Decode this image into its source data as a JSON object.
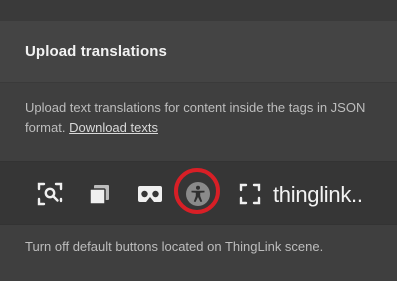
{
  "panel": {
    "title": "Upload translations",
    "description": "Upload text translations for content inside the tags in JSON format. ",
    "download_link": "Download texts",
    "footer_text": "Turn off default buttons located on ThingLink scene."
  },
  "toolbar": {
    "icons": [
      {
        "name": "zoom-select-icon"
      },
      {
        "name": "copy-layers-icon"
      },
      {
        "name": "vr-goggles-icon"
      },
      {
        "name": "accessibility-icon",
        "highlighted": true
      },
      {
        "name": "fullscreen-icon"
      }
    ],
    "brand": "thinglink.."
  },
  "colors": {
    "highlight_ring": "#d81f26",
    "background": "#3f3f3f",
    "toolbar_bg": "#363636"
  }
}
